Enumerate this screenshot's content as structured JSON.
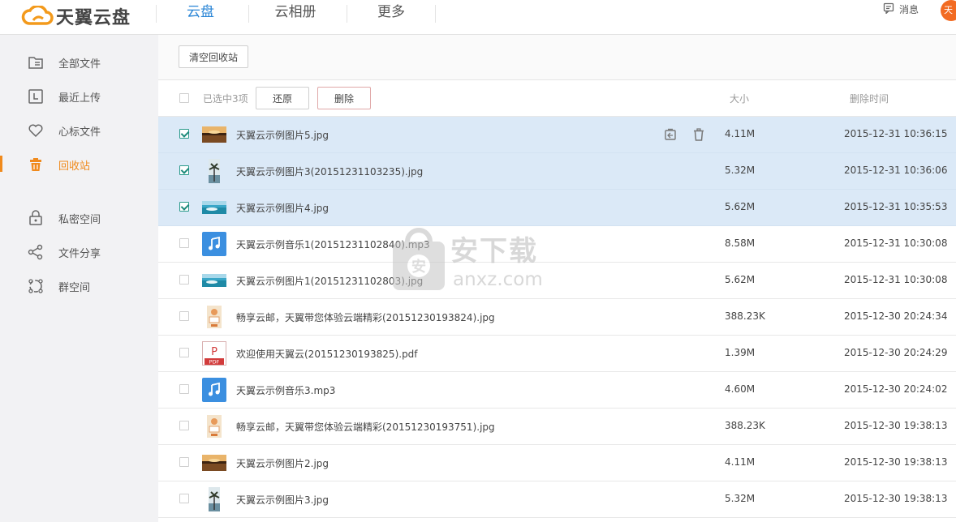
{
  "app": {
    "logo_text": "天翼云盘"
  },
  "nav": {
    "tabs": [
      {
        "label": "云盘",
        "active": true
      },
      {
        "label": "云相册",
        "active": false
      },
      {
        "label": "更多",
        "active": false
      }
    ],
    "messages_label": "消息",
    "avatar_text": "天"
  },
  "sidebar": {
    "items": [
      {
        "label": "全部文件",
        "icon": "folder-icon",
        "active": false
      },
      {
        "label": "最近上传",
        "icon": "clock-icon",
        "active": false
      },
      {
        "label": "心标文件",
        "icon": "heart-icon",
        "active": false
      },
      {
        "label": "回收站",
        "icon": "trash-icon",
        "active": true
      },
      {
        "label": "私密空间",
        "icon": "lock-icon",
        "active": false
      },
      {
        "label": "文件分享",
        "icon": "share-icon",
        "active": false
      },
      {
        "label": "群空间",
        "icon": "group-icon",
        "active": false
      }
    ]
  },
  "toolbar": {
    "empty_recycle_label": "清空回收站"
  },
  "list_header": {
    "selected_text": "已选中3项",
    "restore_label": "还原",
    "delete_label": "删除",
    "col_size": "大小",
    "col_deleted_time": "删除时间"
  },
  "files": [
    {
      "name": "天翼云示例图片5.jpg",
      "size": "4.11M",
      "deleted": "2015-12-31 10:36:15",
      "type": "image-sunset",
      "selected": true
    },
    {
      "name": "天翼云示例图片3(20151231103235).jpg",
      "size": "5.32M",
      "deleted": "2015-12-31 10:36:06",
      "type": "image-palm",
      "selected": true
    },
    {
      "name": "天翼云示例图片4.jpg",
      "size": "5.62M",
      "deleted": "2015-12-31 10:35:53",
      "type": "image-sea",
      "selected": true
    },
    {
      "name": "天翼云示例音乐1(20151231102840).mp3",
      "size": "8.58M",
      "deleted": "2015-12-31 10:30:08",
      "type": "music",
      "selected": false
    },
    {
      "name": "天翼云示例图片1(20151231102803).jpg",
      "size": "5.62M",
      "deleted": "2015-12-31 10:30:08",
      "type": "image-sea",
      "selected": false
    },
    {
      "name": "畅享云邮，天翼带您体验云端精彩(20151230193824).jpg",
      "size": "388.23K",
      "deleted": "2015-12-30 20:24:34",
      "type": "image-promo",
      "selected": false
    },
    {
      "name": "欢迎使用天翼云(20151230193825).pdf",
      "size": "1.39M",
      "deleted": "2015-12-30 20:24:29",
      "type": "pdf",
      "selected": false
    },
    {
      "name": "天翼云示例音乐3.mp3",
      "size": "4.60M",
      "deleted": "2015-12-30 20:24:02",
      "type": "music",
      "selected": false
    },
    {
      "name": "畅享云邮，天翼带您体验云端精彩(20151230193751).jpg",
      "size": "388.23K",
      "deleted": "2015-12-30 19:38:13",
      "type": "image-promo",
      "selected": false
    },
    {
      "name": "天翼云示例图片2.jpg",
      "size": "4.11M",
      "deleted": "2015-12-30 19:38:13",
      "type": "image-sunset",
      "selected": false
    },
    {
      "name": "天翼云示例图片3.jpg",
      "size": "5.32M",
      "deleted": "2015-12-30 19:38:13",
      "type": "image-palm",
      "selected": false
    }
  ],
  "row_actions": {
    "restore_icon": "restore-icon",
    "delete_icon": "delete-icon"
  },
  "watermark": {
    "text": "安下载",
    "sub": "anxz.com"
  },
  "colors": {
    "accent": "#2b86d6",
    "active_orange": "#f08a1c",
    "selected_row": "#dbe9f7"
  }
}
